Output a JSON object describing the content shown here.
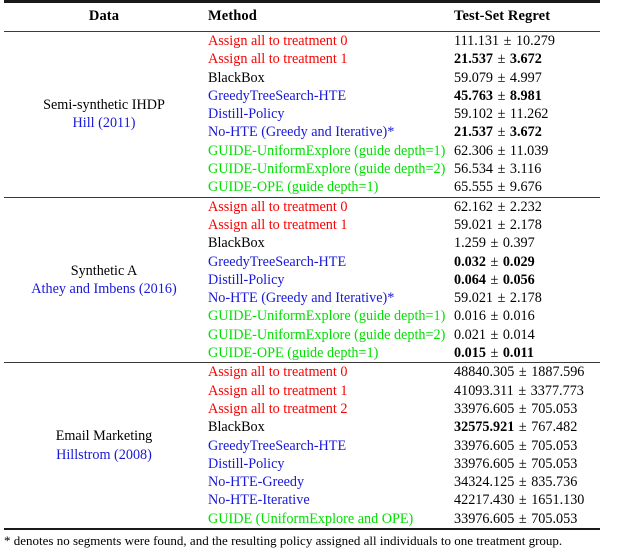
{
  "table": {
    "headers": {
      "data": "Data",
      "method": "Method",
      "regret": "Test-Set Regret"
    },
    "colors": {
      "assign_baseline": "#fa0000",
      "blackbox": "#000000",
      "hte_methods": "#1818d8",
      "guide_methods": "#00e000",
      "citation_link": "#1818d8"
    },
    "blocks": [
      {
        "data_name": "Semi-synthetic IHDP",
        "data_citation": "Hill (2011)",
        "rows": [
          {
            "method": "Assign all to treatment 0",
            "method_color": "red",
            "mean": "111.131",
            "sep": "±",
            "std": "10.279",
            "mean_bold": false,
            "std_bold": false
          },
          {
            "method": "Assign all to treatment 1",
            "method_color": "red",
            "mean": "21.537",
            "sep": "±",
            "std": "3.672",
            "mean_bold": true,
            "std_bold": true
          },
          {
            "method": "BlackBox",
            "method_color": "black",
            "mean": "59.079",
            "sep": "±",
            "std": "4.997",
            "mean_bold": false,
            "std_bold": false
          },
          {
            "method": "GreedyTreeSearch-HTE",
            "method_color": "blue",
            "mean": "45.763",
            "sep": "±",
            "std": "8.981",
            "mean_bold": true,
            "std_bold": true
          },
          {
            "method": "Distill-Policy",
            "method_color": "blue",
            "mean": "59.102",
            "sep": "±",
            "std": "11.262",
            "mean_bold": false,
            "std_bold": false
          },
          {
            "method": "No-HTE (Greedy and Iterative)*",
            "method_color": "blue",
            "mean": "21.537",
            "sep": "±",
            "std": "3.672",
            "mean_bold": true,
            "std_bold": true
          },
          {
            "method": "GUIDE-UniformExplore (guide depth=1)",
            "method_color": "green",
            "mean": "62.306",
            "sep": "±",
            "std": "11.039",
            "mean_bold": false,
            "std_bold": false
          },
          {
            "method": "GUIDE-UniformExplore (guide depth=2)",
            "method_color": "green",
            "mean": "56.534",
            "sep": "±",
            "std": "3.116",
            "mean_bold": false,
            "std_bold": false
          },
          {
            "method": "GUIDE-OPE (guide depth=1)",
            "method_color": "green",
            "mean": "65.555",
            "sep": "±",
            "std": "9.676",
            "mean_bold": false,
            "std_bold": false
          }
        ]
      },
      {
        "data_name": "Synthetic A",
        "data_citation": "Athey and Imbens (2016)",
        "rows": [
          {
            "method": "Assign all to treatment 0",
            "method_color": "red",
            "mean": "62.162",
            "sep": "±",
            "std": "2.232",
            "mean_bold": false,
            "std_bold": false
          },
          {
            "method": "Assign all to treatment 1",
            "method_color": "red",
            "mean": "59.021",
            "sep": "±",
            "std": "2.178",
            "mean_bold": false,
            "std_bold": false
          },
          {
            "method": "BlackBox",
            "method_color": "black",
            "mean": "1.259",
            "sep": "±",
            "std": "0.397",
            "mean_bold": false,
            "std_bold": false
          },
          {
            "method": "GreedyTreeSearch-HTE",
            "method_color": "blue",
            "mean": "0.032",
            "sep": "±",
            "std": "0.029",
            "mean_bold": true,
            "std_bold": true
          },
          {
            "method": "Distill-Policy",
            "method_color": "blue",
            "mean": "0.064",
            "sep": "±",
            "std": "0.056",
            "mean_bold": true,
            "std_bold": true
          },
          {
            "method": "No-HTE (Greedy and Iterative)*",
            "method_color": "blue",
            "mean": "59.021",
            "sep": "±",
            "std": "2.178",
            "mean_bold": false,
            "std_bold": false
          },
          {
            "method": "GUIDE-UniformExplore (guide depth=1)",
            "method_color": "green",
            "mean": "0.016",
            "sep": "±",
            "std": "0.016",
            "mean_bold": false,
            "std_bold": false
          },
          {
            "method": "GUIDE-UniformExplore (guide depth=2)",
            "method_color": "green",
            "mean": "0.021",
            "sep": "±",
            "std": "0.014",
            "mean_bold": false,
            "std_bold": false
          },
          {
            "method": "GUIDE-OPE (guide depth=1)",
            "method_color": "green",
            "mean": "0.015",
            "sep": "±",
            "std": "0.011",
            "mean_bold": true,
            "std_bold": true
          }
        ]
      },
      {
        "data_name": "Email Marketing",
        "data_citation": "Hillstrom (2008)",
        "rows": [
          {
            "method": "Assign all to treatment 0",
            "method_color": "red",
            "mean": "48840.305",
            "sep": "±",
            "std": "1887.596",
            "mean_bold": false,
            "std_bold": false
          },
          {
            "method": "Assign all to treatment 1",
            "method_color": "red",
            "mean": "41093.311",
            "sep": "±",
            "std": "3377.773",
            "mean_bold": false,
            "std_bold": false
          },
          {
            "method": "Assign all to treatment 2",
            "method_color": "red",
            "mean": "33976.605",
            "sep": "±",
            "std": "705.053",
            "mean_bold": false,
            "std_bold": false
          },
          {
            "method": "BlackBox",
            "method_color": "black",
            "mean": "32575.921",
            "sep": "±",
            "std": "767.482",
            "mean_bold": true,
            "std_bold": false
          },
          {
            "method": "GreedyTreeSearch-HTE",
            "method_color": "blue",
            "mean": "33976.605",
            "sep": "±",
            "std": "705.053",
            "mean_bold": false,
            "std_bold": false
          },
          {
            "method": "Distill-Policy",
            "method_color": "blue",
            "mean": "33976.605",
            "sep": "±",
            "std": "705.053",
            "mean_bold": false,
            "std_bold": false
          },
          {
            "method": "No-HTE-Greedy",
            "method_color": "blue",
            "mean": "34324.125",
            "sep": "±",
            "std": "835.736",
            "mean_bold": false,
            "std_bold": false
          },
          {
            "method": "No-HTE-Iterative",
            "method_color": "blue",
            "mean": "42217.430",
            "sep": "±",
            "std": "1651.130",
            "mean_bold": false,
            "std_bold": false
          },
          {
            "method": "GUIDE (UniformExplore and OPE)",
            "method_color": "green",
            "mean": "33976.605",
            "sep": "±",
            "std": "705.053",
            "mean_bold": false,
            "std_bold": false
          }
        ]
      }
    ],
    "footnote": "* denotes no segments were found, and the resulting policy assigned all individuals to one treatment group."
  }
}
